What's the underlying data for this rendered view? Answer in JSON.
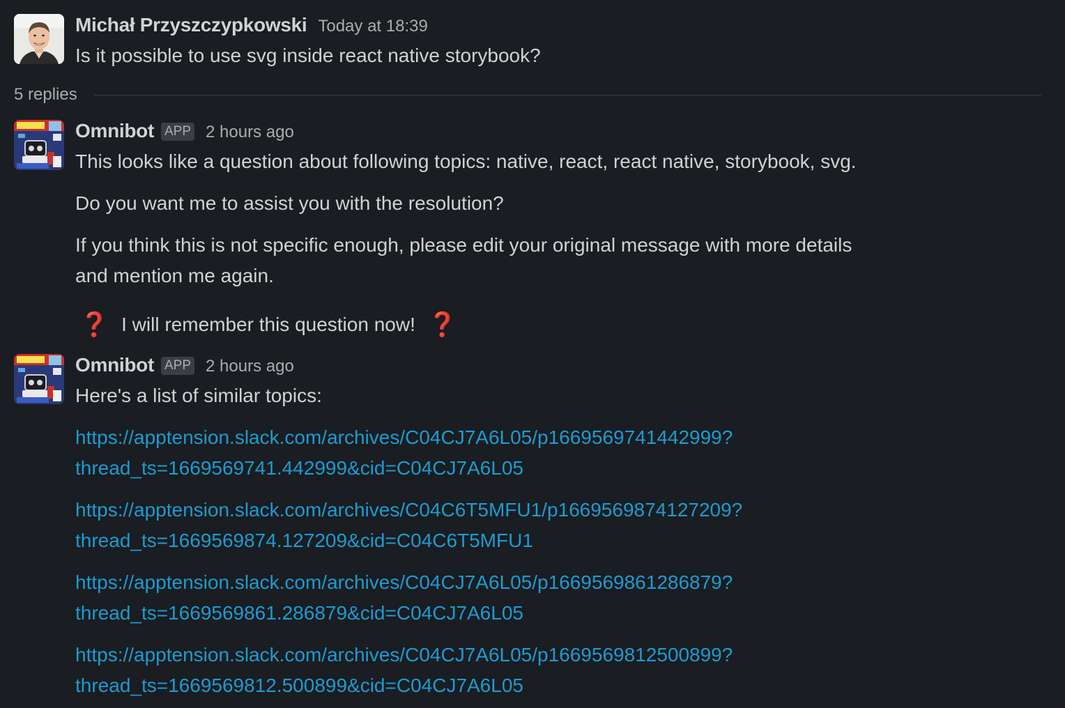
{
  "messages": [
    {
      "author": "Michał Przyszczypkowski",
      "timestamp": "Today at 18:39",
      "text": "Is it possible to use svg inside react native storybook?"
    }
  ],
  "thread": {
    "replies_label": "5 replies"
  },
  "bot_reply_1": {
    "author": "Omnibot",
    "badge": "APP",
    "timestamp": "2 hours ago",
    "para1": "This looks like a question about following topics: native, react, react native, storybook, svg.",
    "para2": "Do you want me to assist you with the resolution?",
    "para3_line1": "If you think this is not specific enough, please edit your original message with more details",
    "para3_line2": "and mention me again.",
    "emoji_name": "question-mark-emoji",
    "remember_text": "I will remember this question now!"
  },
  "bot_reply_2": {
    "author": "Omnibot",
    "badge": "APP",
    "timestamp": "2 hours ago",
    "intro": "Here's a list of similar topics:",
    "links": [
      {
        "line1": "https://apptension.slack.com/archives/C04CJ7A6L05/p1669569741442999?",
        "line2": "thread_ts=1669569741.442999&cid=C04CJ7A6L05"
      },
      {
        "line1": "https://apptension.slack.com/archives/C04C6T5MFU1/p1669569874127209?",
        "line2": "thread_ts=1669569874.127209&cid=C04C6T5MFU1"
      },
      {
        "line1": "https://apptension.slack.com/archives/C04CJ7A6L05/p1669569861286879?",
        "line2": "thread_ts=1669569861.286879&cid=C04CJ7A6L05"
      },
      {
        "line1": "https://apptension.slack.com/archives/C04CJ7A6L05/p1669569812500899?",
        "line2": "thread_ts=1669569812.500899&cid=C04CJ7A6L05"
      }
    ]
  },
  "colors": {
    "background": "#1a1d21",
    "text": "#d1d2d3",
    "muted": "#abacad",
    "link": "#1d9bd1",
    "emoji_red": "#dd2e44"
  }
}
